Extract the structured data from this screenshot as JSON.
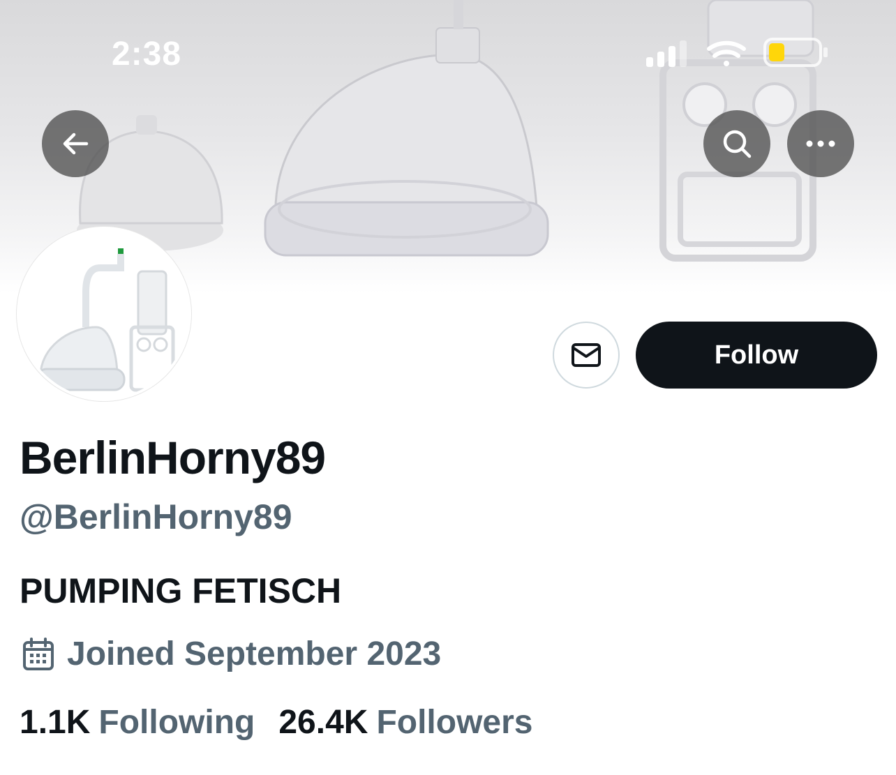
{
  "status_bar": {
    "time": "2:38",
    "signal_icon": "cellular-signal-icon",
    "wifi_icon": "wifi-icon",
    "battery_icon": "battery-low-icon",
    "battery_color": "#ffd60a"
  },
  "header": {
    "back_icon": "arrow-left-icon",
    "search_icon": "search-icon",
    "more_icon": "more-horizontal-icon"
  },
  "actions": {
    "message_icon": "envelope-icon",
    "follow_label": "Follow"
  },
  "profile": {
    "display_name": "BerlinHorny89",
    "handle": "@BerlinHorny89",
    "bio": "PUMPING FETISCH",
    "joined_icon": "calendar-icon",
    "joined": "Joined September 2023",
    "following_count": "1.1K",
    "following_label": "Following",
    "followers_count": "26.4K",
    "followers_label": "Followers"
  },
  "colors": {
    "primary_text": "#0f1419",
    "secondary_text": "#536471",
    "follow_button_bg": "#0f1419",
    "overlay_button_bg": "#505050"
  }
}
